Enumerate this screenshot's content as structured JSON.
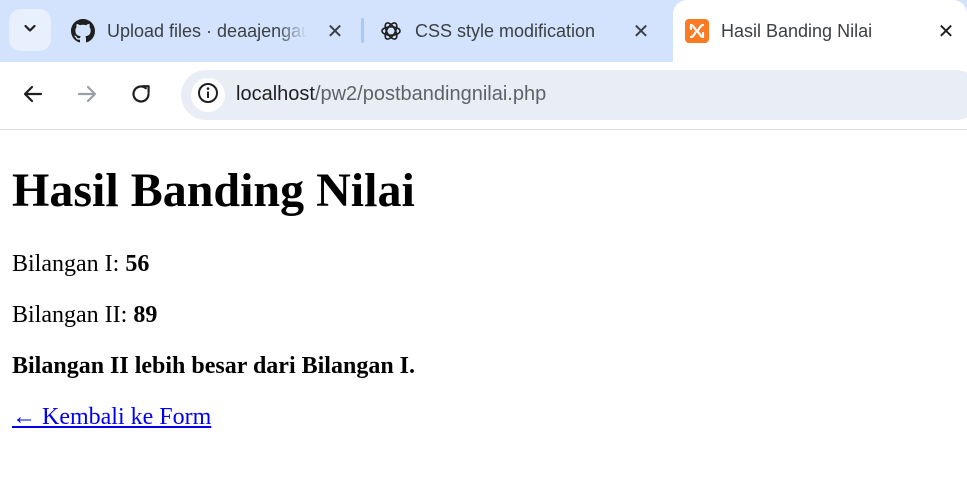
{
  "browser": {
    "tabs": [
      {
        "title": "Upload files · deaajengaulia",
        "icon": "github-icon",
        "active": false
      },
      {
        "title": "CSS style modification",
        "icon": "chatgpt-icon",
        "active": false
      },
      {
        "title": "Hasil Banding Nilai",
        "icon": "xampp-icon",
        "active": true
      }
    ],
    "address": {
      "host": "localhost",
      "path": "/pw2/postbandingnilai.php"
    },
    "colors": {
      "tabstrip_bg": "#d3e3fd",
      "omnibox_bg": "#e9eef6",
      "xampp_orange": "#fb7a24"
    }
  },
  "page": {
    "heading": "Hasil Banding Nilai",
    "bilangan1": {
      "label": "Bilangan I: ",
      "value": "56"
    },
    "bilangan2": {
      "label": "Bilangan II: ",
      "value": "89"
    },
    "result": "Bilangan II lebih besar dari Bilangan I.",
    "back_link": "← Kembali ke Form",
    "link_color": "#0000ee"
  }
}
